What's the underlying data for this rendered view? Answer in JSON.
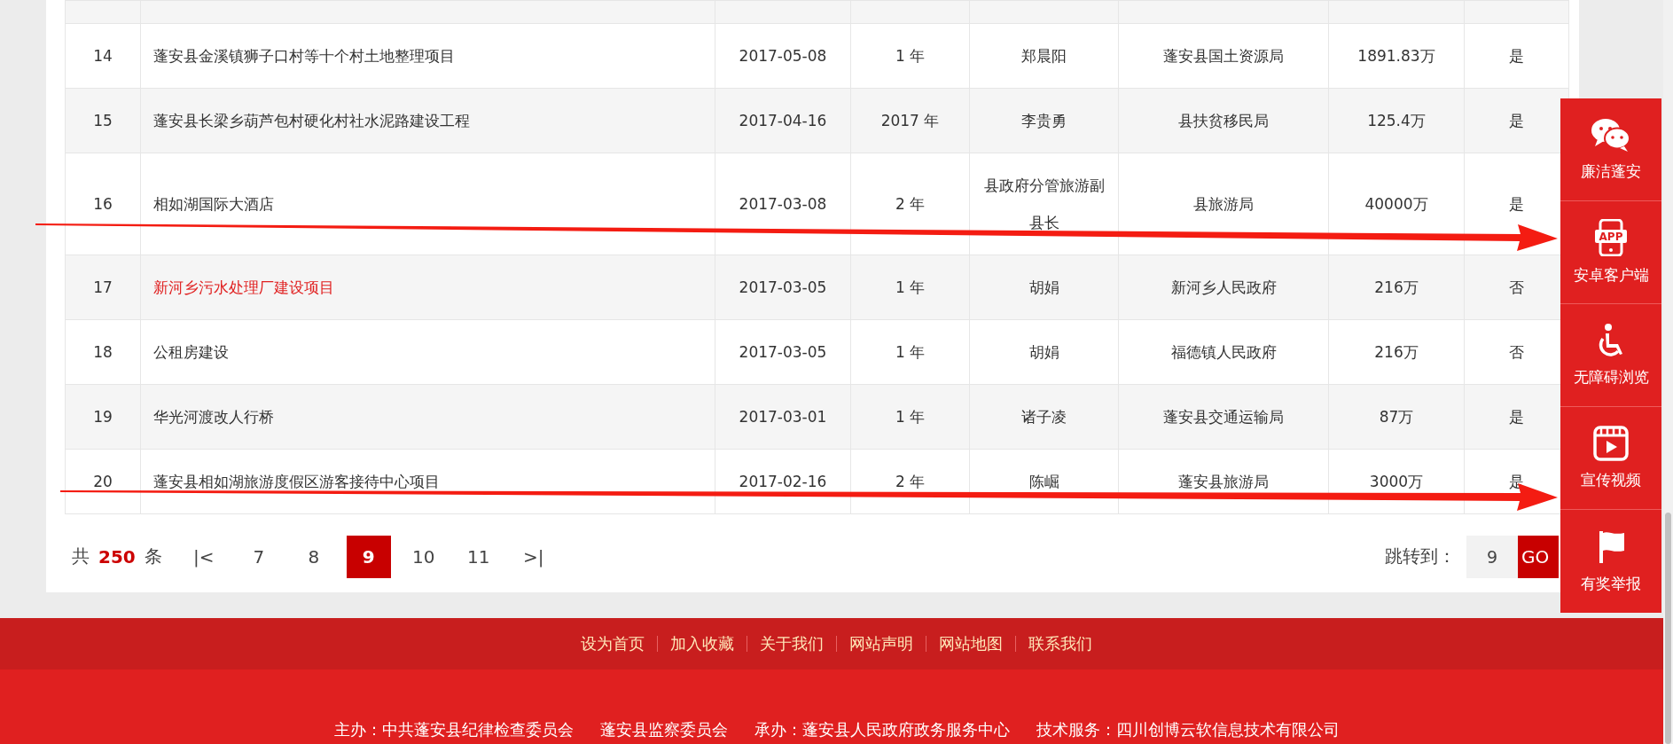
{
  "table": {
    "rows": [
      {
        "cells": [
          "14",
          "蓬安县金溪镇狮子口村等十个村土地整理项目",
          "2017-05-08",
          "1 年",
          "郑晨阳",
          "蓬安县国土资源局",
          "1891.83万",
          "是"
        ],
        "highlighted": false
      },
      {
        "cells": [
          "15",
          "蓬安县长梁乡葫芦包村硬化村社水泥路建设工程",
          "2017-04-16",
          "2017 年",
          "李贵勇",
          "县扶贫移民局",
          "125.4万",
          "是"
        ],
        "highlighted": false
      },
      {
        "cells": [
          "16",
          "相如湖国际大酒店",
          "2017-03-08",
          "2 年",
          "县政府分管旅游副县长",
          "县旅游局",
          "40000万",
          "是"
        ],
        "highlighted": false
      },
      {
        "cells": [
          "17",
          "新河乡污水处理厂建设项目",
          "2017-03-05",
          "1 年",
          "胡娟",
          "新河乡人民政府",
          "216万",
          "否"
        ],
        "highlighted": true
      },
      {
        "cells": [
          "18",
          "公租房建设",
          "2017-03-05",
          "1 年",
          "胡娟",
          "福德镇人民政府",
          "216万",
          "否"
        ],
        "highlighted": false
      },
      {
        "cells": [
          "19",
          "华光河渡改人行桥",
          "2017-03-01",
          "1 年",
          "诸子凌",
          "蓬安县交通运输局",
          "87万",
          "是"
        ],
        "highlighted": false
      },
      {
        "cells": [
          "20",
          "蓬安县相如湖旅游度假区游客接待中心项目",
          "2017-02-16",
          "2 年",
          "陈崛",
          "蓬安县旅游局",
          "3000万",
          "是"
        ],
        "highlighted": false
      }
    ]
  },
  "pagination": {
    "total_prefix": "共",
    "total": "250",
    "total_suffix": "条",
    "first": "|<",
    "pages": [
      {
        "label": "7",
        "selected": false
      },
      {
        "label": "8",
        "selected": false
      },
      {
        "label": "9",
        "selected": true
      },
      {
        "label": "10",
        "selected": false
      },
      {
        "label": "11",
        "selected": false
      }
    ],
    "last": ">|",
    "jump_label": "跳转到：",
    "jump_value": "9",
    "go": "GO"
  },
  "sidebar": [
    {
      "kind": "chat",
      "label": "廉洁蓬安"
    },
    {
      "kind": "app",
      "label": "安卓客户端",
      "icon_text": "APP"
    },
    {
      "kind": "wheelchair",
      "label": "无障碍浏览"
    },
    {
      "kind": "video",
      "label": "宣传视频"
    },
    {
      "kind": "flag",
      "label": "有奖举报"
    }
  ],
  "footer": {
    "links": [
      "设为首页",
      "加入收藏",
      "关于我们",
      "网站声明",
      "网站地图",
      "联系我们"
    ],
    "credits": [
      "主办：中共蓬安县纪律检查委员会",
      "蓬安县监察委员会",
      "承办：蓬安县人民政府政务服务中心",
      "技术服务：四川创博云软信息技术有限公司"
    ]
  }
}
